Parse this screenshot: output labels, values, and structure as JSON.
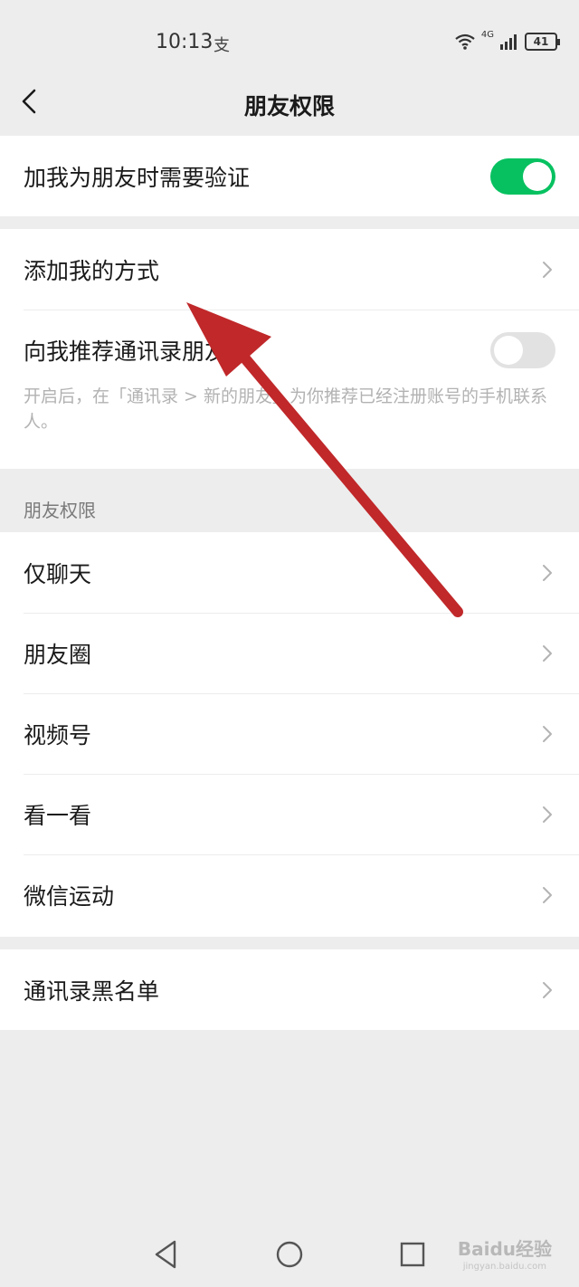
{
  "status_bar": {
    "time": "10:13",
    "extra": "支",
    "network": "4G",
    "battery": "41"
  },
  "nav": {
    "title": "朋友权限"
  },
  "verify_row": {
    "label": "加我为朋友时需要验证",
    "toggle_on": true
  },
  "add_methods_row": {
    "label": "添加我的方式"
  },
  "recommend_row": {
    "label": "向我推荐通讯录朋友",
    "toggle_on": false,
    "description": "开启后，在「通讯录 > 新的朋友」为你推荐已经注册账号的手机联系人。"
  },
  "permissions_section": {
    "header": "朋友权限",
    "items": [
      {
        "label": "仅聊天"
      },
      {
        "label": "朋友圈"
      },
      {
        "label": "视频号"
      },
      {
        "label": "看一看"
      },
      {
        "label": "微信运动"
      }
    ]
  },
  "blacklist_row": {
    "label": "通讯录黑名单"
  },
  "watermark": {
    "brand": "Baidu经验",
    "sub": "jingyan.baidu.com"
  },
  "colors": {
    "toggle_on": "#07c160",
    "toggle_off": "#e2e2e2",
    "arrow": "#c0282a",
    "background": "#ededed"
  }
}
